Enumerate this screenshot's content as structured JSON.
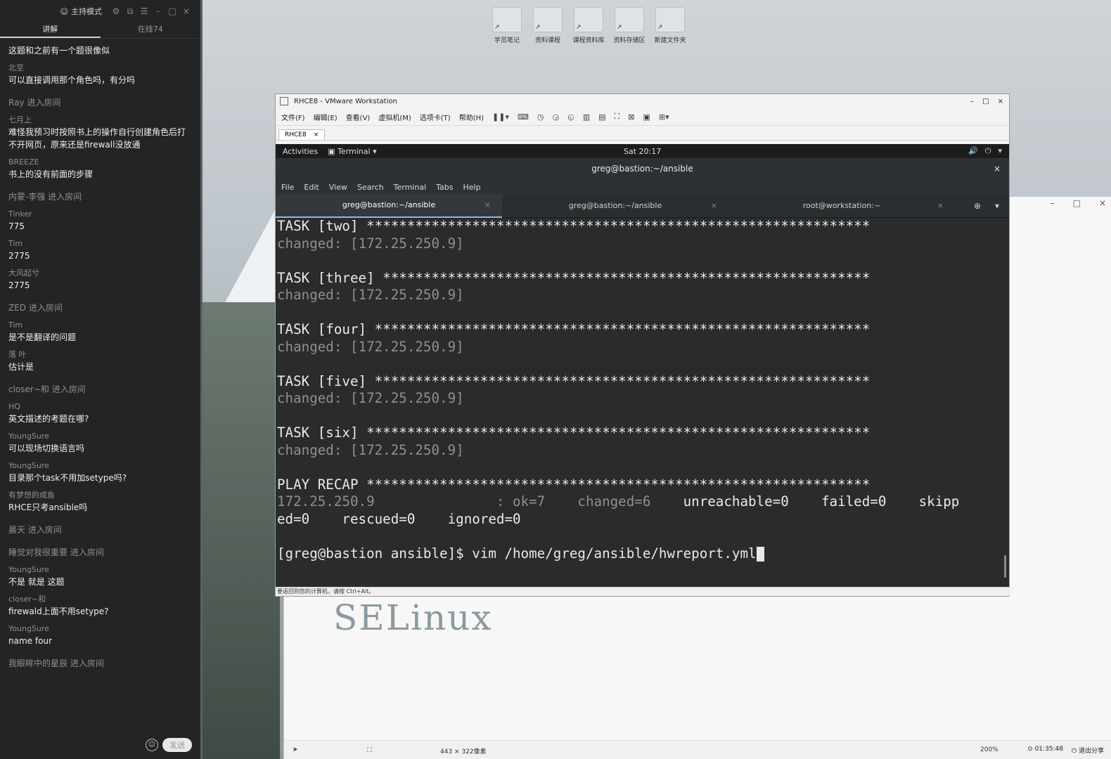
{
  "chat": {
    "mode_label": "主持模式",
    "tabs": [
      "讲解",
      "在线74"
    ],
    "messages": [
      {
        "nick": "",
        "text": "这题和之前有一个题很像似"
      },
      {
        "nick": "北至",
        "text": "可以直接调用那个角色吗，有分吗"
      },
      {
        "join": true,
        "nick": "Ray",
        "text": "进入房间"
      },
      {
        "nick": "七月上",
        "text": "难怪我预习时按照书上的操作自行创建角色后打不开网页，原来还是firewall没放通"
      },
      {
        "nick": "BREEZE",
        "text": "书上的没有前面的步骤"
      },
      {
        "join": true,
        "nick": "内蒙-李强",
        "text": "进入房间"
      },
      {
        "nick": "Tinker",
        "text": "775"
      },
      {
        "nick": "Tim",
        "text": "2775"
      },
      {
        "nick": "大风起兮",
        "text": "2775"
      },
      {
        "join": true,
        "nick": "ZED",
        "text": "进入房间"
      },
      {
        "nick": "Tim",
        "text": "是不是翻译的问题"
      },
      {
        "nick": "落 叶",
        "text": "估计是"
      },
      {
        "join": true,
        "nick": "closer~和",
        "text": "进入房间"
      },
      {
        "nick": "HQ",
        "text": "英文描述的考题在哪?"
      },
      {
        "nick": "YoungSure",
        "text": "可以现场切换语言吗"
      },
      {
        "nick": "YoungSure",
        "text": "目录那个task不用加setype吗?"
      },
      {
        "nick": "有梦想的咸鱼",
        "text": "RHCE只考ansible吗"
      },
      {
        "join": true,
        "nick": "晨天",
        "text": "进入房间"
      },
      {
        "join": true,
        "nick": "睡觉对我很重要",
        "text": "进入房间"
      },
      {
        "nick": "YoungSure",
        "text": "不是  就是 这题"
      },
      {
        "nick": "closer~和",
        "text": "firewald上面不用setype?"
      },
      {
        "nick": "YoungSure",
        "text": "name four"
      },
      {
        "join": true,
        "nick": "我眼眸中的星辰",
        "text": "进入房间"
      }
    ],
    "send_label": "发送"
  },
  "desktop": {
    "icons": [
      "学员笔记",
      "资料课程",
      "课程资料库",
      "资料存储区",
      "新建文件夹"
    ]
  },
  "bg_window": {
    "selinux_text": "SELinux",
    "status": {
      "size": "443 × 322像素",
      "zoom": "200%"
    }
  },
  "vmware": {
    "title": "RHCE8 - VMware Workstation",
    "menu": [
      "文件(F)",
      "编辑(E)",
      "查看(V)",
      "虚拟机(M)",
      "选项卡(T)",
      "帮助(H)"
    ],
    "tab": "RHCE8",
    "status_text": "要返回到您的计算机，请按 Ctrl+Alt。"
  },
  "gnome": {
    "activities": "Activities",
    "app": "Terminal",
    "clock": "Sat 20:17"
  },
  "terminal": {
    "title": "greg@bastion:~/ansible",
    "menu": [
      "File",
      "Edit",
      "View",
      "Search",
      "Terminal",
      "Tabs",
      "Help"
    ],
    "tabs": [
      "greg@bastion:~/ansible",
      "greg@bastion:~/ansible",
      "root@workstation:~"
    ],
    "lines": [
      {
        "t": "TASK [two] **************************************************************",
        "c": ""
      },
      {
        "t": "changed: [172.25.250.9]",
        "c": "dim"
      },
      {
        "t": "",
        "c": ""
      },
      {
        "t": "TASK [three] ************************************************************",
        "c": ""
      },
      {
        "t": "changed: [172.25.250.9]",
        "c": "dim"
      },
      {
        "t": "",
        "c": ""
      },
      {
        "t": "TASK [four] *************************************************************",
        "c": ""
      },
      {
        "t": "changed: [172.25.250.9]",
        "c": "dim"
      },
      {
        "t": "",
        "c": ""
      },
      {
        "t": "TASK [five] *************************************************************",
        "c": ""
      },
      {
        "t": "changed: [172.25.250.9]",
        "c": "dim"
      },
      {
        "t": "",
        "c": ""
      },
      {
        "t": "TASK [six] **************************************************************",
        "c": ""
      },
      {
        "t": "changed: [172.25.250.9]",
        "c": "dim"
      },
      {
        "t": "",
        "c": ""
      },
      {
        "t": "PLAY RECAP **************************************************************",
        "c": ""
      },
      {
        "t": "172.25.250.9               : ok=7    changed=6    unreachable=0    failed=0    skipp",
        "c": "recap"
      },
      {
        "t": "ed=0    rescued=0    ignored=0",
        "c": ""
      },
      {
        "t": "",
        "c": ""
      }
    ],
    "prompt": "[greg@bastion ansible]$ vim /home/greg/ansible/hwreport.yml"
  },
  "tray": {
    "time": "01:35:48",
    "share": "退出分享"
  }
}
